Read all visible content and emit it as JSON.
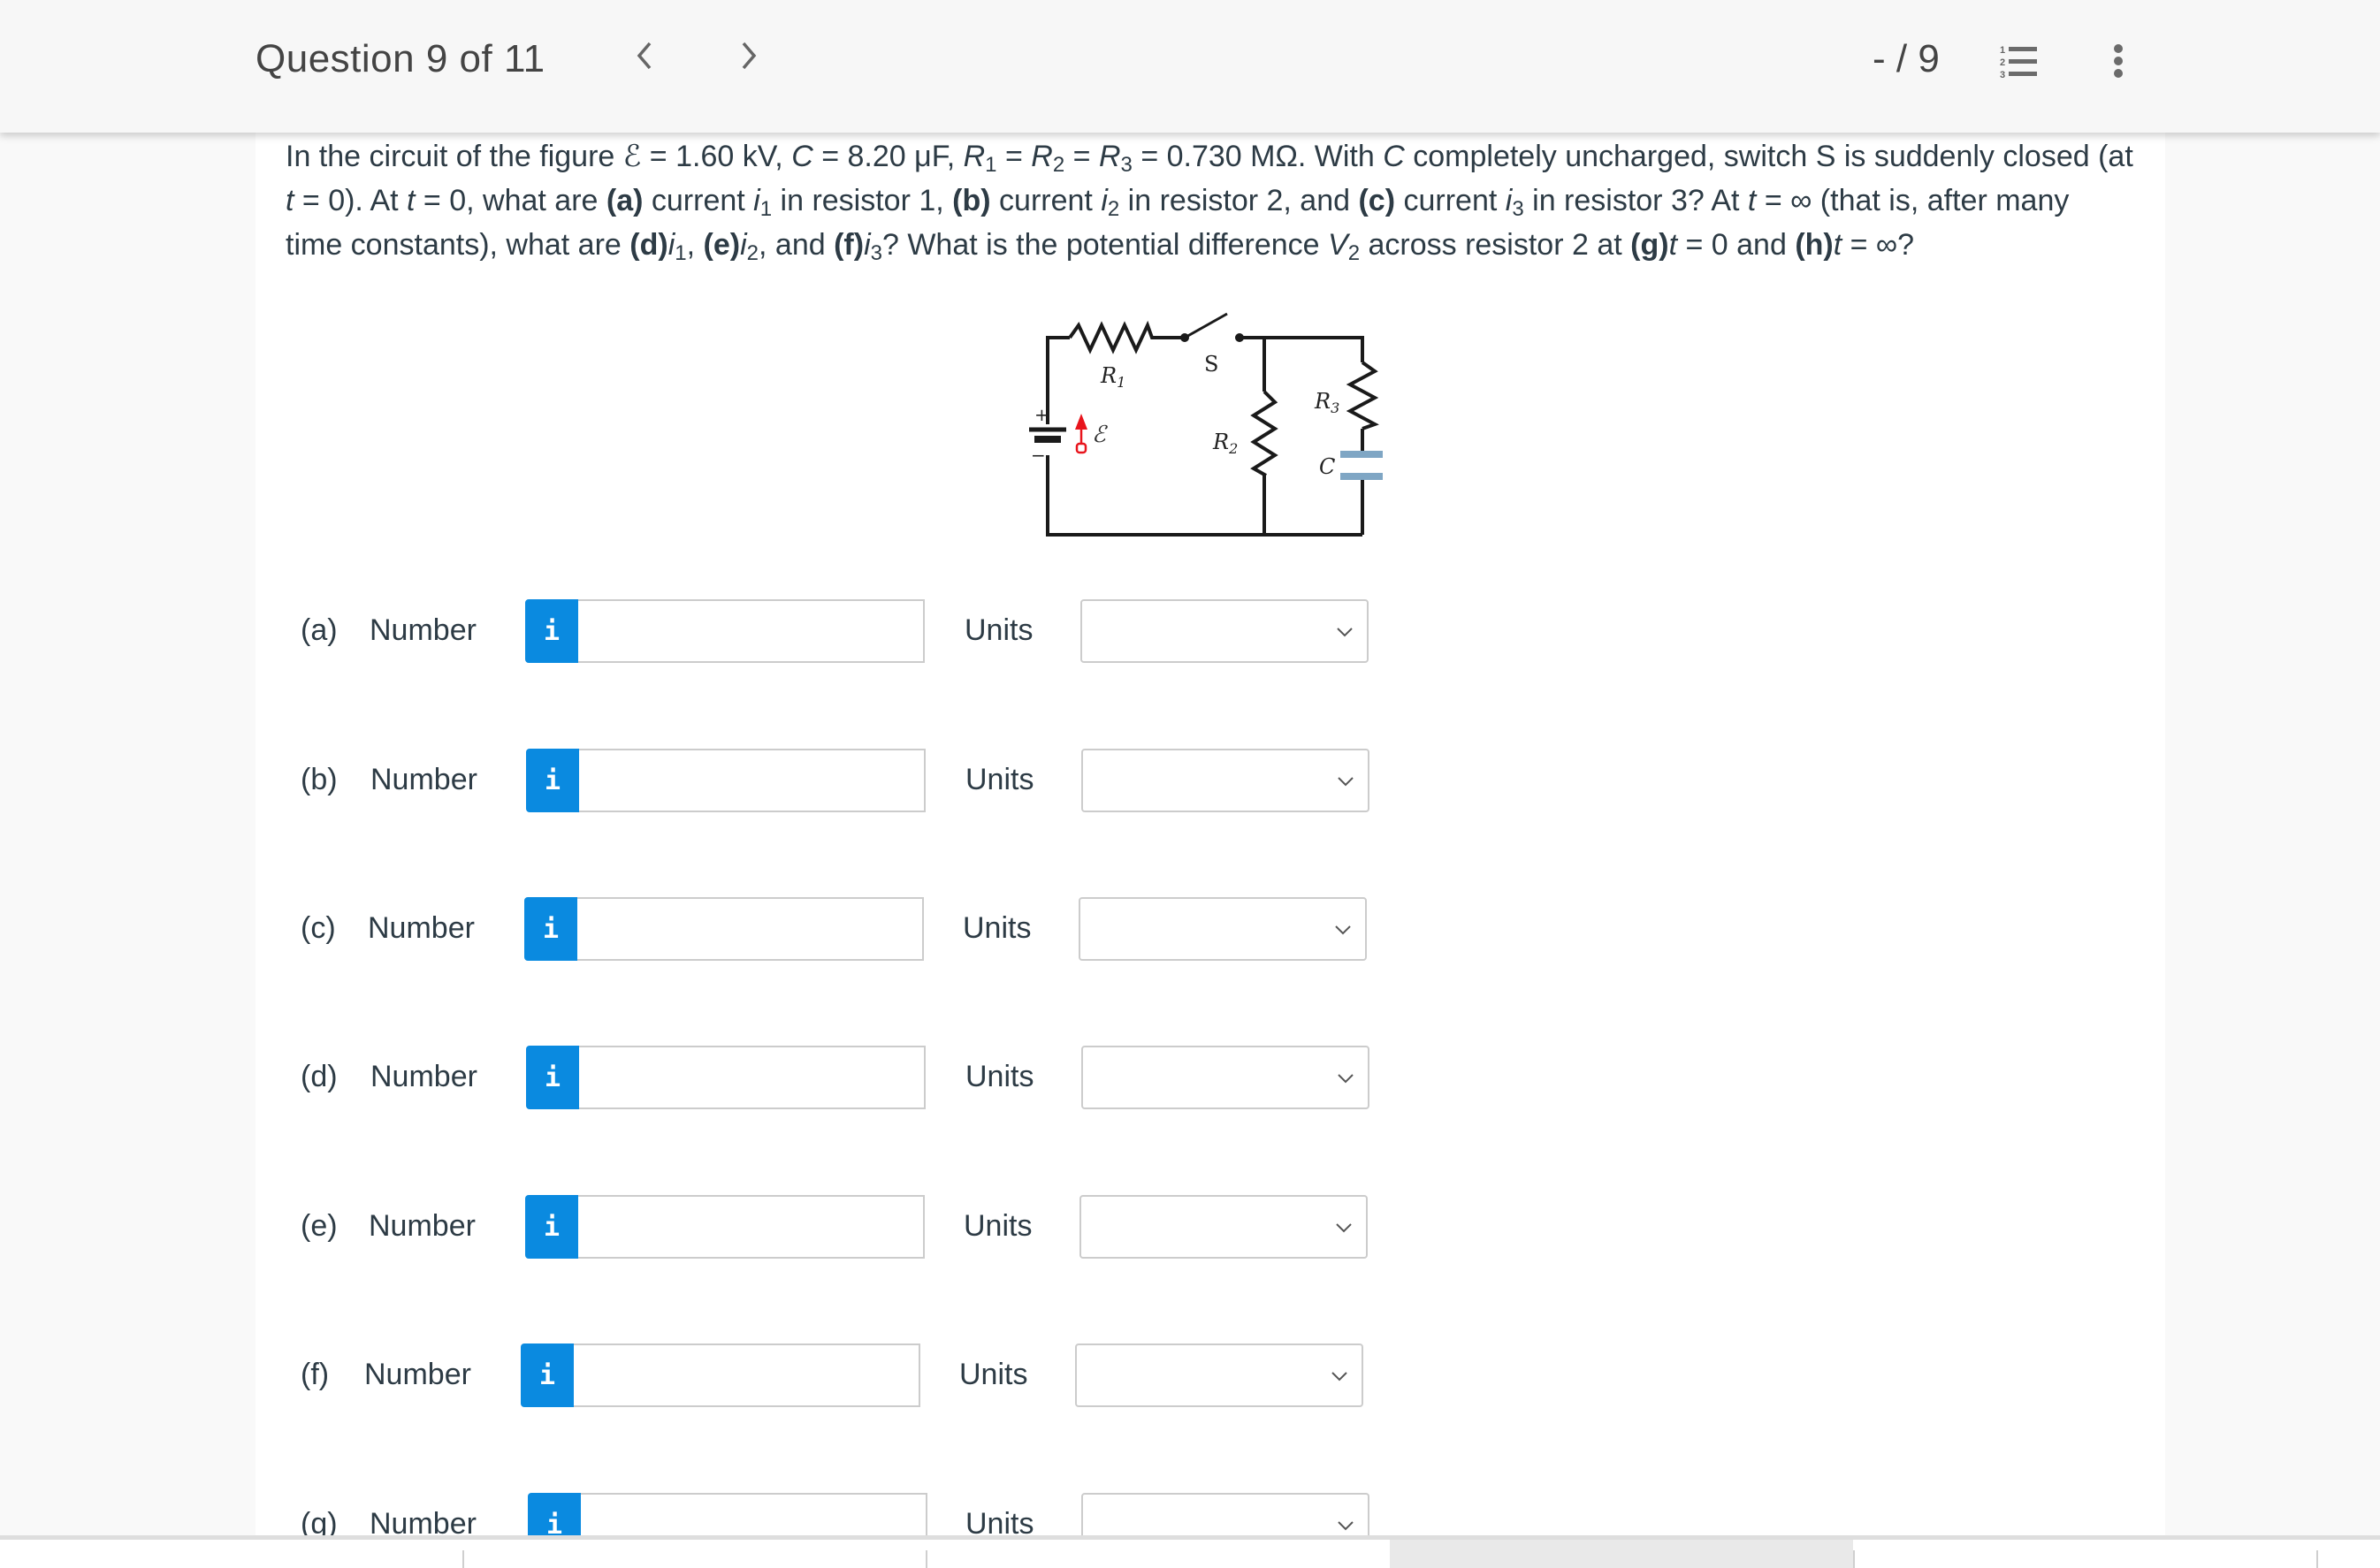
{
  "header": {
    "question_position": "Question 9 of 11",
    "prev_icon": "chevron-left-icon",
    "next_icon": "chevron-right-icon",
    "score": "- / 9",
    "list_icon": "numbered-list-icon",
    "more_icon": "more-vertical-icon"
  },
  "question": {
    "segments": {
      "l1a": "In the circuit of the figure ",
      "emf": "ℰ",
      "l1b": " = 1.60 kV, ",
      "C": "C",
      "l1c": " = 8.20 μF, ",
      "R": "R",
      "s1": "1",
      "eq": " = ",
      "s2": "2",
      "s3": "3",
      "l1d": " = 0.730 MΩ. With ",
      "l1e": " completely uncharged, switch S is suddenly closed (at ",
      "t": "t",
      "l2a": " = 0). At ",
      "l2b": " = 0, what are ",
      "pa": "(a)",
      "l2c": " current ",
      "i": "i",
      "l2d": " in resistor 1, ",
      "pb": "(b)",
      "l2e": " in resistor 2, and ",
      "pc": "(c)",
      "l2f": " in resistor 3? At ",
      "l2g": " = ∞ (that is, after many time constants), what are ",
      "pd": "(d)",
      "comma": ", ",
      "pe": "(e)",
      "and": ", and ",
      "pf": "(f)",
      "l3a": "? What is the potential difference ",
      "V": "V",
      "l3b": " across resistor 2 at ",
      "pg": "(g)",
      "l3c": " = 0 and ",
      "ph": "(h)",
      "l3d": " = ∞?"
    }
  },
  "figure": {
    "labels": {
      "R1": "R",
      "R1_sub": "1",
      "R2": "R",
      "R2_sub": "2",
      "R3": "R",
      "R3_sub": "3",
      "switch": "S",
      "capacitor": "C",
      "emf": "ℰ",
      "plus": "+",
      "minus": "−"
    },
    "colors": {
      "wire": "#1a1a1a",
      "capacitor": "#7fa6c4",
      "emf_arrow": "#e8141c"
    }
  },
  "parts": [
    {
      "letter": "(a)",
      "number_label": "Number",
      "info": "i",
      "value": "",
      "units_label": "Units",
      "units_value": ""
    },
    {
      "letter": "(b)",
      "number_label": "Number",
      "info": "i",
      "value": "",
      "units_label": "Units",
      "units_value": ""
    },
    {
      "letter": "(c)",
      "number_label": "Number",
      "info": "i",
      "value": "",
      "units_label": "Units",
      "units_value": ""
    },
    {
      "letter": "(d)",
      "number_label": "Number",
      "info": "i",
      "value": "",
      "units_label": "Units",
      "units_value": ""
    },
    {
      "letter": "(e)",
      "number_label": "Number",
      "info": "i",
      "value": "",
      "units_label": "Units",
      "units_value": ""
    },
    {
      "letter": "(f)",
      "number_label": "Number",
      "info": "i",
      "value": "",
      "units_label": "Units",
      "units_value": ""
    },
    {
      "letter": "(g)",
      "number_label": "Number",
      "info": "i",
      "value": "",
      "units_label": "Units",
      "units_value": ""
    }
  ],
  "theme": {
    "info_button": "#0a8ae0",
    "text": "#2d3b45",
    "border": "#cccccc"
  }
}
